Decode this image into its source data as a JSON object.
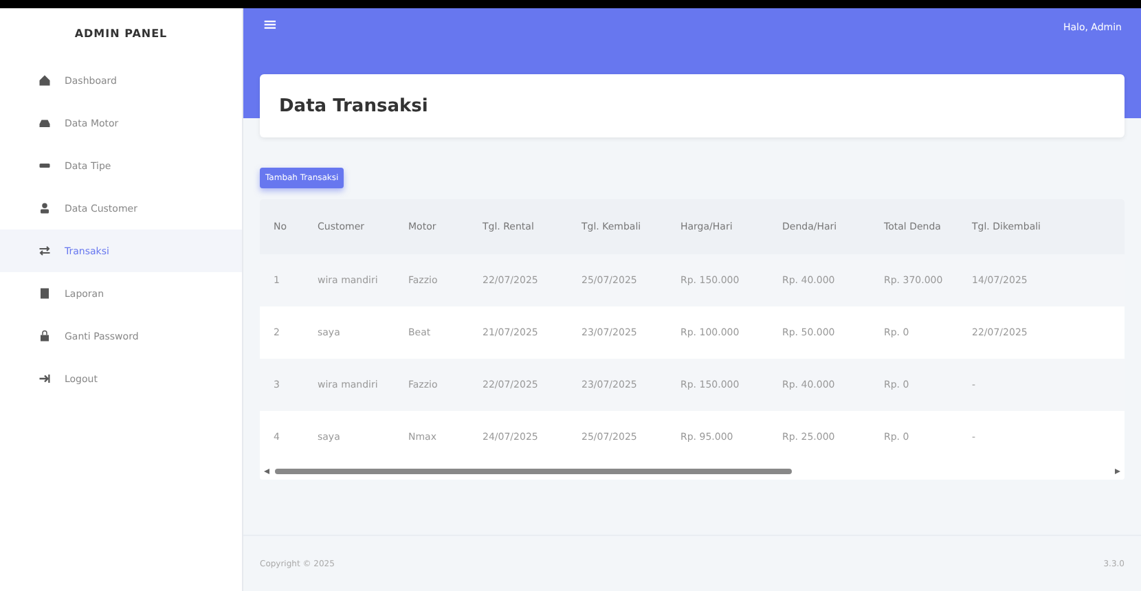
{
  "sidebar": {
    "title": "ADMIN PANEL",
    "items": [
      {
        "label": "Dashboard",
        "selected": false
      },
      {
        "label": "Data Motor",
        "selected": false
      },
      {
        "label": "Data Tipe",
        "selected": false
      },
      {
        "label": "Data Customer",
        "selected": false
      },
      {
        "label": "Transaksi",
        "selected": true
      },
      {
        "label": "Laporan",
        "selected": false
      },
      {
        "label": "Ganti Password",
        "selected": false
      },
      {
        "label": "Logout",
        "selected": false
      }
    ]
  },
  "topbar": {
    "menu_icon": "≡",
    "greeting": "Halo, Admin"
  },
  "page_title": "Data Transaksi",
  "add_button": "Tambah Transaksi",
  "table": {
    "columns": [
      "No",
      "Customer",
      "Motor",
      "Tgl. Rental",
      "Tgl. Kembali",
      "Harga/Hari",
      "Denda/Hari",
      "Total Denda",
      "Tgl. Dikembali"
    ],
    "rows": [
      [
        "1",
        "wira mandiri",
        "Fazzio",
        "22/07/2025",
        "25/07/2025",
        "Rp. 150.000",
        "Rp. 40.000",
        "Rp. 370.000",
        "14/07/2025"
      ],
      [
        "2",
        "saya",
        "Beat",
        "21/07/2025",
        "23/07/2025",
        "Rp. 100.000",
        "Rp. 50.000",
        "Rp. 0",
        "22/07/2025"
      ],
      [
        "3",
        "wira mandiri",
        "Fazzio",
        "22/07/2025",
        "23/07/2025",
        "Rp. 150.000",
        "Rp. 40.000",
        "Rp. 0",
        "-"
      ],
      [
        "4",
        "saya",
        "Nmax",
        "24/07/2025",
        "25/07/2025",
        "Rp. 95.000",
        "Rp. 25.000",
        "Rp. 0",
        "-"
      ]
    ]
  },
  "footer": {
    "copyright": "Copyright © 2025",
    "version": "3.3.0"
  }
}
